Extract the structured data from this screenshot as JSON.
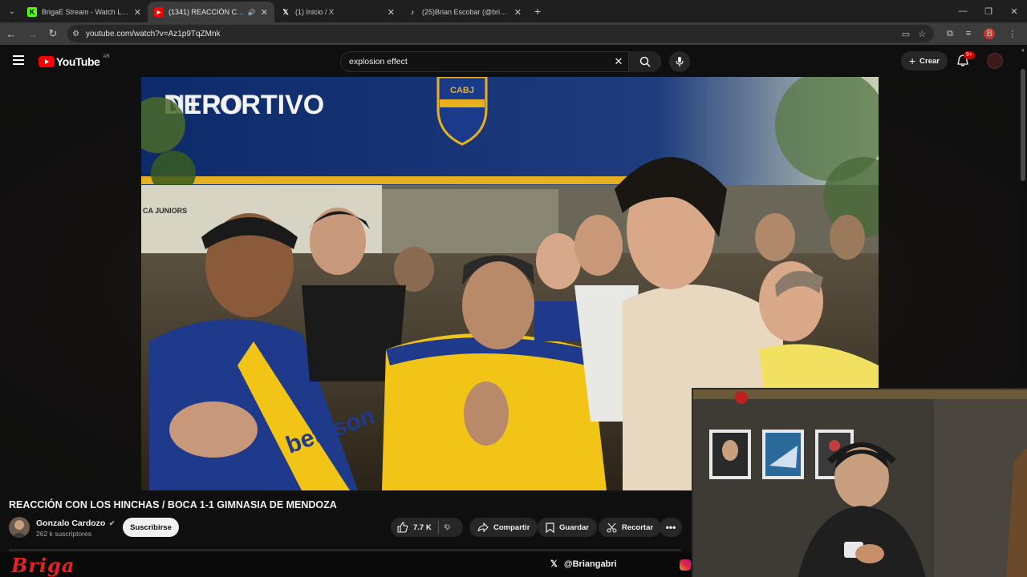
{
  "browser": {
    "tabs": [
      {
        "title": "BrigaE Stream - Watch Live on K",
        "favicon": "kick-icon",
        "active": false
      },
      {
        "title": "(1341) REACCIÓN CON LOS H",
        "favicon": "youtube-icon",
        "active": true
      },
      {
        "title": "(1) Inicio / X",
        "favicon": "x-icon",
        "active": false
      },
      {
        "title": "(25)Brian Escobar (@brigaesc) |",
        "favicon": "tiktok-icon",
        "active": false
      }
    ],
    "url": "youtube.com/watch?v=Az1p9TqZMnk",
    "profile_initial": "B"
  },
  "youtube": {
    "logo_text": "YouTube",
    "country_code": "AR",
    "search_query": "explosion effect",
    "create_label": "Crear",
    "notif_badge": "9+",
    "video": {
      "title": "REACCIÓN CON LOS HINCHAS / BOCA 1-1 GIMNASIA DE MENDOZA",
      "channel": "Gonzalo Cardozo",
      "subscribers": "262 k suscriptores",
      "subscribe_label": "Suscribirse",
      "likes": "7.7 K",
      "share_label": "Compartir",
      "save_label": "Guardar",
      "clip_label": "Recortar"
    },
    "scene_text": {
      "banner": "DEPORTIVO",
      "banner_top": "NTRO",
      "crest": "CABJ",
      "wall_text": "CA JUNIORS",
      "jersey": "betsson"
    }
  },
  "stream": {
    "brand": "Briga",
    "handle": "@Briangabri"
  },
  "colors": {
    "youtube_red": "#ff0000",
    "boca_blue": "#1f3a8a",
    "boca_yellow": "#f2c416",
    "briga_red": "#e02424"
  }
}
